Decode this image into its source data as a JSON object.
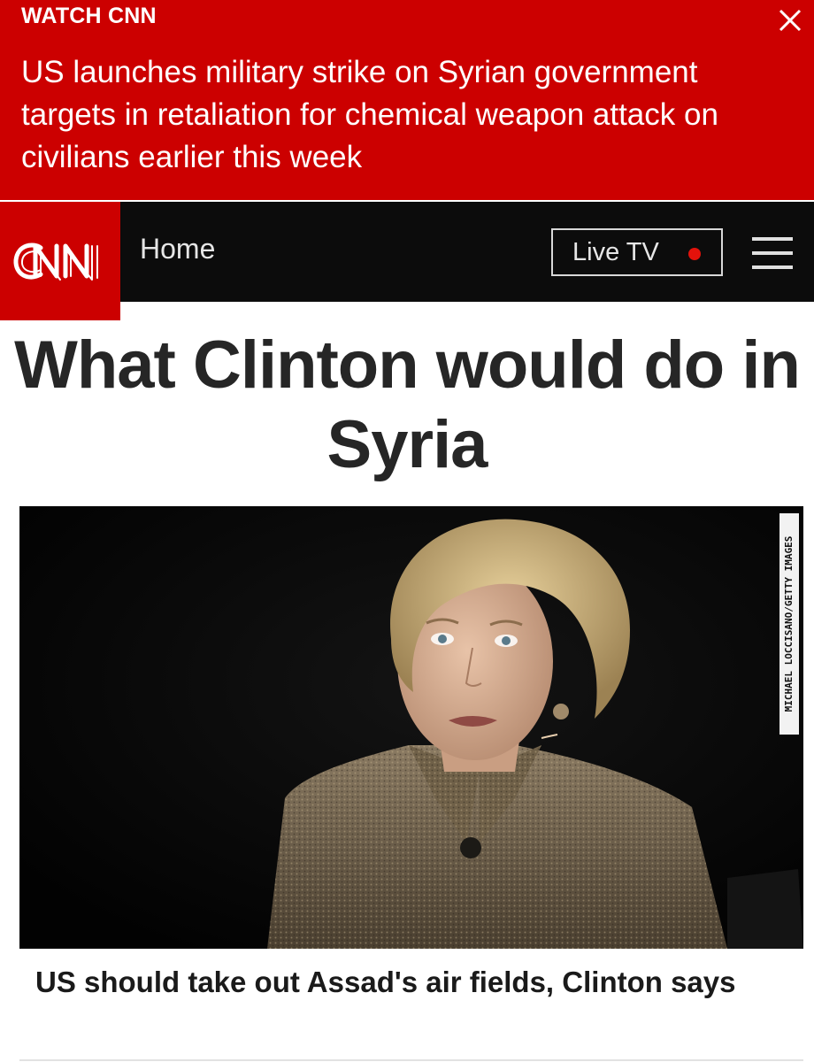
{
  "breaking_banner": {
    "kicker": "WATCH CNN",
    "headline": "US launches military strike on Syrian government targets in retaliation for chemical weapon attack on civilians earlier this week",
    "close_icon": "close-icon",
    "background_color": "#cc0000"
  },
  "navbar": {
    "logo": "CNN",
    "home_label": "Home",
    "live_tv_label": "Live TV",
    "live_indicator_color": "#e3120b",
    "menu_icon": "hamburger-menu-icon"
  },
  "article": {
    "title": "What Clinton would do in Syria",
    "photo_credit": "MICHAEL LOCCISANO/GETTY IMAGES",
    "caption": "US should take out Assad's air fields, Clinton says"
  }
}
